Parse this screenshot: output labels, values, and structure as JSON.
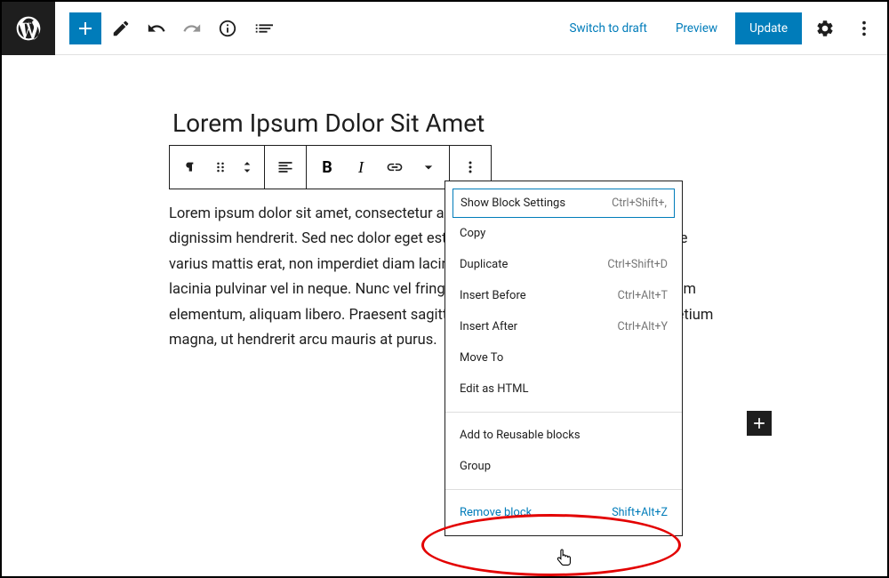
{
  "header": {
    "switch_to_draft": "Switch to draft",
    "preview": "Preview",
    "update": "Update"
  },
  "post": {
    "title": "Lorem Ipsum Dolor Sit Amet",
    "body": "Lorem ipsum dolor sit amet, consectetur adipiscing elit. Vestibulum quis ipsum dignissim hendrerit. Sed nec dolor eget est ornare gravida ac sed diam. Quisque varius mattis erat, non imperdiet diam lacinia eu. Vestibulum et feugiat nunc, at lacinia pulvinar vel in neque. Nunc vel fringilla dui. Donec pharetra tincidunt lorem elementum, aliquam libero. Praesent sagittis ultrices justo. Morbi in erat est pretium magna, ut hendrerit arcu mauris at purus."
  },
  "toolbar": {
    "bold": "B",
    "italic": "I"
  },
  "menu": {
    "show_block_settings": {
      "label": "Show Block Settings",
      "shortcut": "Ctrl+Shift+,"
    },
    "copy": {
      "label": "Copy",
      "shortcut": ""
    },
    "duplicate": {
      "label": "Duplicate",
      "shortcut": "Ctrl+Shift+D"
    },
    "insert_before": {
      "label": "Insert Before",
      "shortcut": "Ctrl+Alt+T"
    },
    "insert_after": {
      "label": "Insert After",
      "shortcut": "Ctrl+Alt+Y"
    },
    "move_to": {
      "label": "Move To",
      "shortcut": ""
    },
    "edit_html": {
      "label": "Edit as HTML",
      "shortcut": ""
    },
    "reusable": {
      "label": "Add to Reusable blocks",
      "shortcut": ""
    },
    "group": {
      "label": "Group",
      "shortcut": ""
    },
    "remove": {
      "label": "Remove block",
      "shortcut": "Shift+Alt+Z"
    }
  }
}
